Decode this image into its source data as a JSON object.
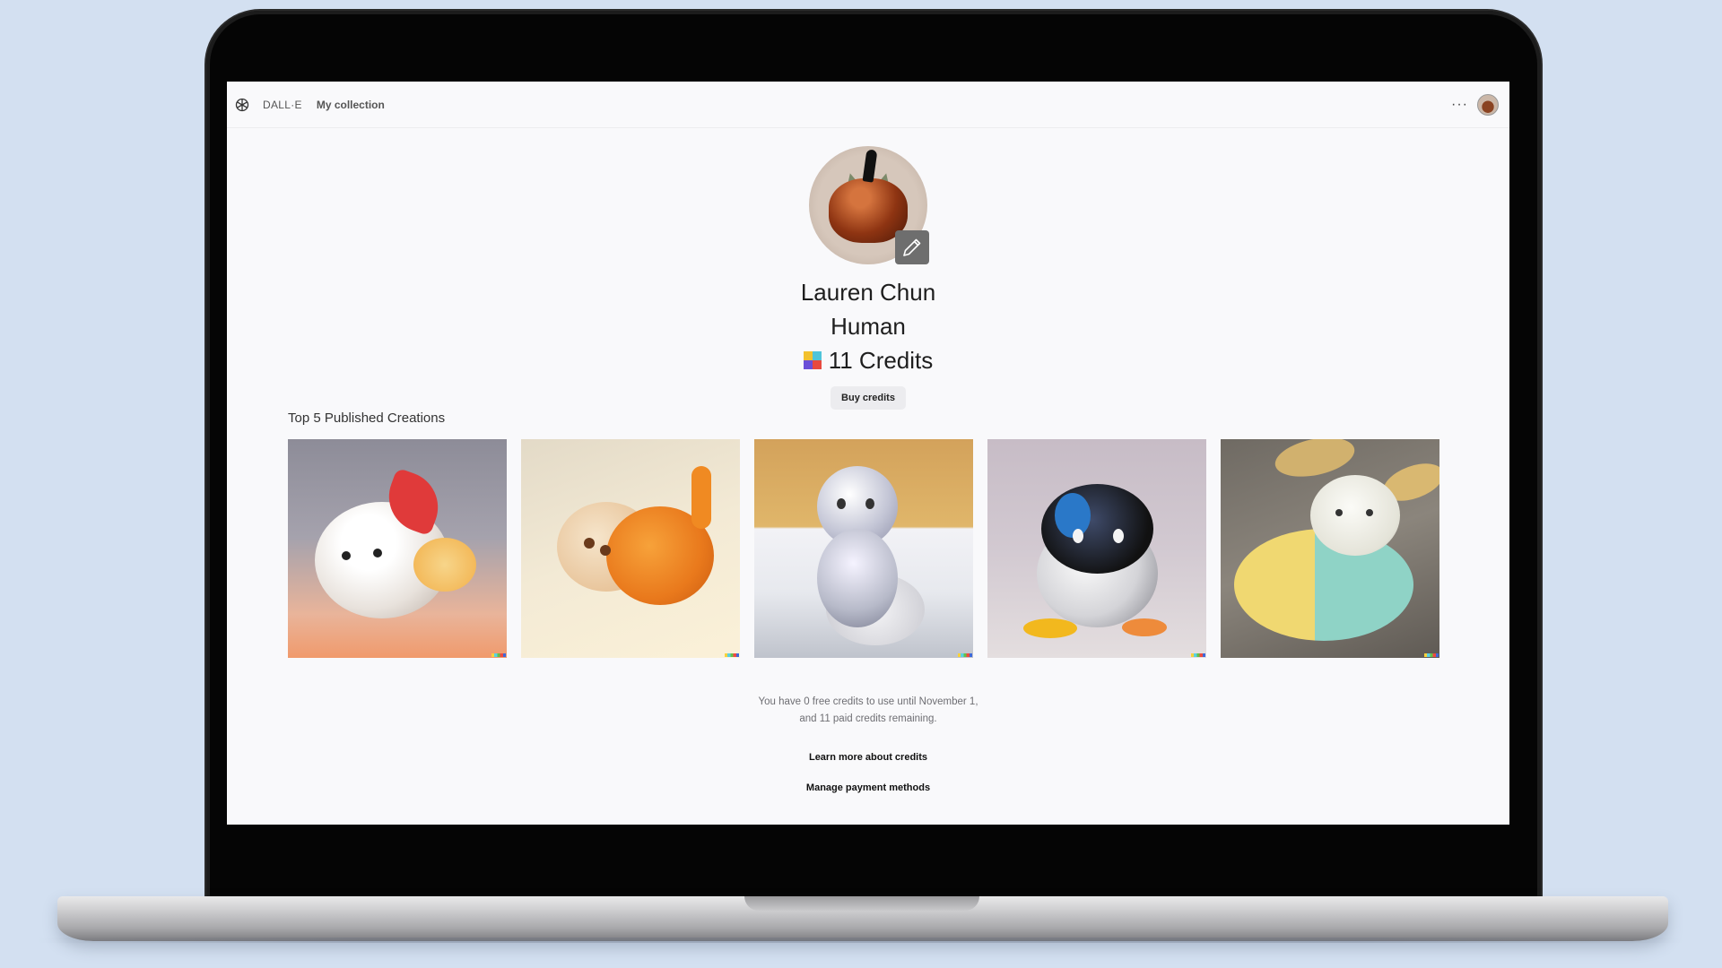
{
  "nav": {
    "brand": "DALL·E",
    "collection": "My collection",
    "more": "···"
  },
  "profile": {
    "name": "Lauren Chun",
    "title": "Human",
    "credits": "11 Credits",
    "buy_label": "Buy credits"
  },
  "gallery": {
    "title": "Top 5 Published Creations",
    "items": [
      {
        "subject": "white-red glossy cat"
      },
      {
        "subject": "orange glass cat"
      },
      {
        "subject": "translucent sitting cat"
      },
      {
        "subject": "black-white cat"
      },
      {
        "subject": "yellow-blue glass cat"
      }
    ]
  },
  "footer": {
    "credit_info_line1": "You have 0 free credits to use until November 1,",
    "credit_info_line2": "and 11 paid credits remaining.",
    "learn_more": "Learn more about credits",
    "manage_payment": "Manage payment methods"
  },
  "colors": {
    "background": "#d3e0f1",
    "screen": "#f9f9fb",
    "button": "#ececef"
  }
}
